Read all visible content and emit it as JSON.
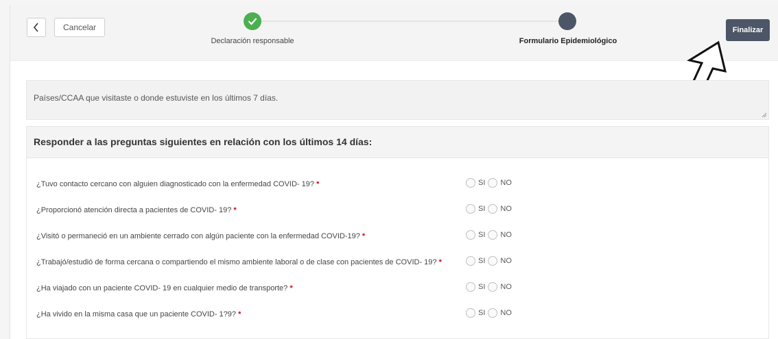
{
  "header": {
    "cancel_label": "Cancelar",
    "finish_label": "Finalizar",
    "steps": [
      {
        "label": "Declaración responsable",
        "status": "completed"
      },
      {
        "label": "Formulario Epidemiológico",
        "status": "current"
      }
    ]
  },
  "countries_field": {
    "placeholder": "Países/CCAA que visitaste o donde estuviste en los últimos 7 días."
  },
  "questions_panel": {
    "title": "Responder a las preguntas siguientes en relación con los últimos 14 días:",
    "required_mark": "*",
    "yes_label": "SI",
    "no_label": "NO",
    "questions": [
      "¿Tuvo contacto cercano con alguien diagnosticado con la enfermedad COVID- 19?",
      "¿Proporcionó atención directa a pacientes de COVID- 19?",
      "¿Visitó o permaneció en un ambiente cerrado con algún paciente con la enfermedad COVID-19?",
      "¿Trabajó/estudió de forma cercana o compartiendo el mismo ambiente laboral o de clase con pacientes de COVID- 19?",
      "¿Ha viajado con un paciente COVID- 19 en cualquier medio de transporte?",
      "¿Ha vivido en la misma casa que un paciente COVID- 1?9?"
    ]
  },
  "colors": {
    "accent": "#4c5666",
    "success": "#4caf50",
    "required": "#d0021b"
  }
}
